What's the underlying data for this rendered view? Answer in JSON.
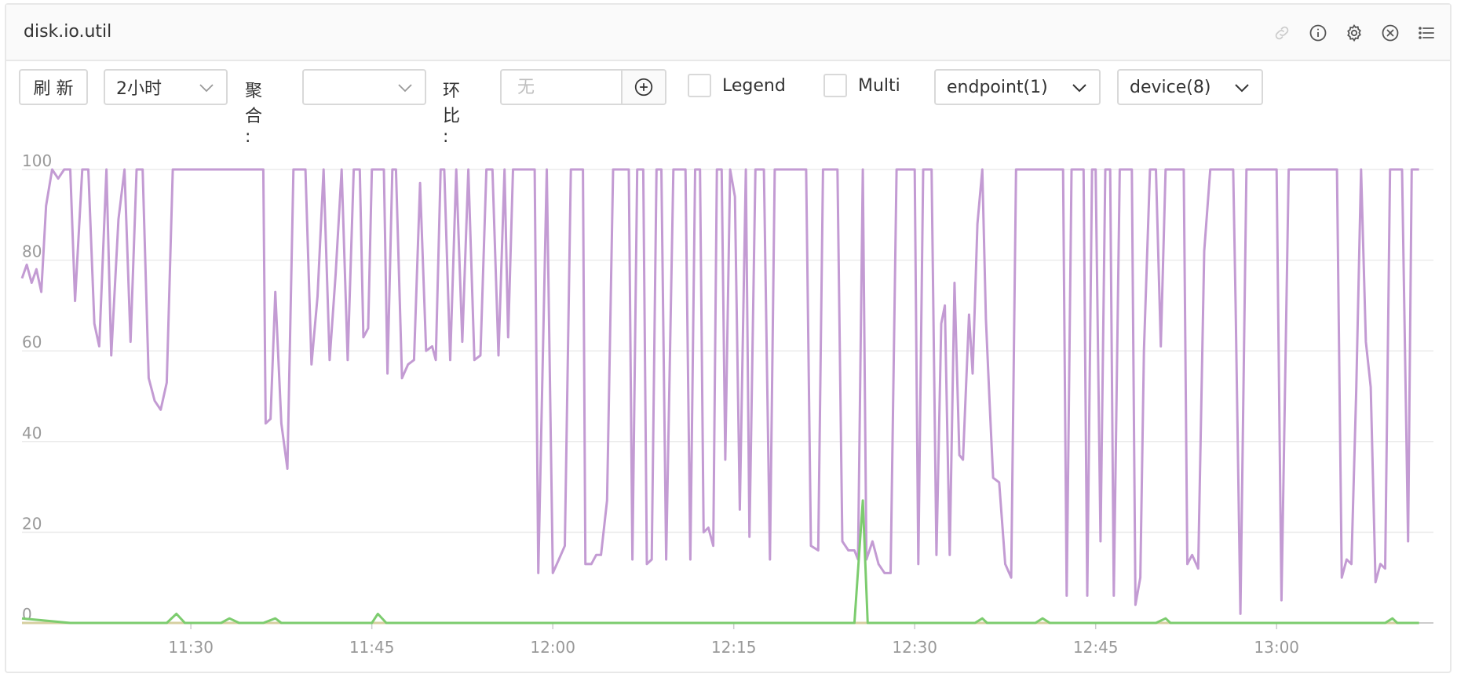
{
  "panel": {
    "title": "disk.io.util",
    "icons": [
      "link-icon",
      "info-icon",
      "gear-icon",
      "close-icon",
      "list-icon"
    ]
  },
  "toolbar": {
    "refresh_label": "刷 新",
    "time_range": "2小时",
    "aggregate_label": "聚合 :",
    "aggregate_value": "",
    "compare_label": "环比 :",
    "compare_placeholder": "无",
    "legend_label": "Legend",
    "multi_label": "Multi",
    "endpoint_label": "endpoint(1)",
    "device_label": "device(8)"
  },
  "colors": {
    "series_primary": "#c39bd3",
    "series_green": "#7ccc6e",
    "series_tan": "#d6cfa0",
    "grid": "#ebebeb",
    "axis": "#cccccc"
  },
  "chart_data": {
    "type": "line",
    "ylim": [
      0,
      100
    ],
    "y_ticks": [
      0,
      20,
      40,
      60,
      80,
      100
    ],
    "x_tick_labels": [
      "11:30",
      "11:45",
      "12:00",
      "12:15",
      "12:30",
      "12:45",
      "13:00"
    ],
    "x_tick_minutes": [
      690,
      705,
      720,
      735,
      750,
      765,
      780
    ],
    "x_range_minutes": [
      676,
      793
    ],
    "series": [
      {
        "color": "#c39bd3",
        "points": [
          [
            676,
            76
          ],
          [
            676.4,
            79
          ],
          [
            676.8,
            75
          ],
          [
            677.2,
            78
          ],
          [
            677.6,
            73
          ],
          [
            678,
            92
          ],
          [
            678.5,
            100
          ],
          [
            679,
            98
          ],
          [
            679.5,
            100
          ],
          [
            680,
            100
          ],
          [
            680.4,
            71
          ],
          [
            681,
            100
          ],
          [
            681.5,
            100
          ],
          [
            682,
            66
          ],
          [
            682.4,
            61
          ],
          [
            683,
            100
          ],
          [
            683.4,
            59
          ],
          [
            684,
            89
          ],
          [
            684.5,
            100
          ],
          [
            685,
            62
          ],
          [
            685.5,
            100
          ],
          [
            686,
            100
          ],
          [
            686.5,
            54
          ],
          [
            687,
            49
          ],
          [
            687.5,
            47
          ],
          [
            688,
            53
          ],
          [
            688.5,
            100
          ],
          [
            692,
            100
          ],
          [
            692,
            100
          ],
          [
            696,
            100
          ],
          [
            696.2,
            44
          ],
          [
            696.6,
            45
          ],
          [
            697,
            73
          ],
          [
            697.5,
            44
          ],
          [
            698,
            34
          ],
          [
            698.5,
            100
          ],
          [
            699.5,
            100
          ],
          [
            700,
            57
          ],
          [
            700.5,
            72
          ],
          [
            701,
            100
          ],
          [
            701.5,
            58
          ],
          [
            702,
            77
          ],
          [
            702.5,
            100
          ],
          [
            703,
            58
          ],
          [
            703.5,
            100
          ],
          [
            704,
            100
          ],
          [
            704.3,
            63
          ],
          [
            704.7,
            65
          ],
          [
            705,
            100
          ],
          [
            706,
            100
          ],
          [
            706.3,
            55
          ],
          [
            706.7,
            100
          ],
          [
            707,
            100
          ],
          [
            707.5,
            54
          ],
          [
            708,
            57
          ],
          [
            708.5,
            58
          ],
          [
            709,
            97
          ],
          [
            709.5,
            60
          ],
          [
            710,
            61
          ],
          [
            710.3,
            58
          ],
          [
            710.7,
            100
          ],
          [
            711,
            100
          ],
          [
            711.5,
            58
          ],
          [
            712,
            100
          ],
          [
            712.5,
            62
          ],
          [
            713,
            100
          ],
          [
            713.5,
            58
          ],
          [
            714,
            59
          ],
          [
            714.5,
            100
          ],
          [
            715,
            100
          ],
          [
            715.5,
            59
          ],
          [
            716,
            100
          ],
          [
            716.3,
            63
          ],
          [
            716.7,
            100
          ],
          [
            718.5,
            100
          ],
          [
            718.8,
            11
          ],
          [
            719.5,
            100
          ],
          [
            720,
            11
          ],
          [
            720.5,
            14
          ],
          [
            721,
            17
          ],
          [
            721.5,
            100
          ],
          [
            722.5,
            100
          ],
          [
            722.7,
            13
          ],
          [
            723.2,
            13
          ],
          [
            723.6,
            15
          ],
          [
            724,
            15
          ],
          [
            724.5,
            27
          ],
          [
            725,
            100
          ],
          [
            726.3,
            100
          ],
          [
            726.6,
            14
          ],
          [
            727,
            100
          ],
          [
            727.5,
            100
          ],
          [
            727.8,
            13
          ],
          [
            728.2,
            14
          ],
          [
            728.6,
            100
          ],
          [
            729,
            100
          ],
          [
            729.4,
            14
          ],
          [
            730,
            100
          ],
          [
            731,
            100
          ],
          [
            731.4,
            14
          ],
          [
            731.8,
            100
          ],
          [
            732.2,
            100
          ],
          [
            732.5,
            20
          ],
          [
            732.9,
            21
          ],
          [
            733.3,
            17
          ],
          [
            733.6,
            100
          ],
          [
            734,
            100
          ],
          [
            734.3,
            36
          ],
          [
            734.7,
            100
          ],
          [
            735.1,
            94
          ],
          [
            735.5,
            25
          ],
          [
            736,
            100
          ],
          [
            736.3,
            19
          ],
          [
            736.8,
            100
          ],
          [
            737.5,
            100
          ],
          [
            738,
            14
          ],
          [
            738.4,
            100
          ],
          [
            741,
            100
          ],
          [
            741.4,
            17
          ],
          [
            742,
            16
          ],
          [
            742.4,
            100
          ],
          [
            743.6,
            100
          ],
          [
            744,
            18
          ],
          [
            744.5,
            16
          ],
          [
            745,
            16
          ],
          [
            745.3,
            14
          ],
          [
            745.7,
            100
          ],
          [
            746,
            14
          ],
          [
            746.5,
            18
          ],
          [
            747,
            13
          ],
          [
            747.5,
            11
          ],
          [
            748,
            11
          ],
          [
            748.5,
            100
          ],
          [
            750,
            100
          ],
          [
            750.3,
            13
          ],
          [
            750.7,
            100
          ],
          [
            751.4,
            100
          ],
          [
            751.8,
            15
          ],
          [
            752.2,
            66
          ],
          [
            752.5,
            70
          ],
          [
            752.9,
            15
          ],
          [
            753.3,
            75
          ],
          [
            753.7,
            37
          ],
          [
            754,
            36
          ],
          [
            754.5,
            68
          ],
          [
            754.8,
            55
          ],
          [
            755.2,
            88
          ],
          [
            755.6,
            100
          ],
          [
            755.9,
            67
          ],
          [
            756.2,
            49
          ],
          [
            756.5,
            32
          ],
          [
            757,
            31
          ],
          [
            757.5,
            13
          ],
          [
            758,
            10
          ],
          [
            758.4,
            100
          ],
          [
            762.3,
            100
          ],
          [
            762.6,
            6
          ],
          [
            763,
            100
          ],
          [
            764,
            100
          ],
          [
            764.3,
            6
          ],
          [
            764.7,
            100
          ],
          [
            765,
            100
          ],
          [
            765.4,
            18
          ],
          [
            765.8,
            100
          ],
          [
            766.2,
            100
          ],
          [
            766.5,
            6
          ],
          [
            767,
            100
          ],
          [
            768,
            100
          ],
          [
            768.3,
            4
          ],
          [
            768.7,
            10
          ],
          [
            769,
            60
          ],
          [
            769.5,
            100
          ],
          [
            770,
            100
          ],
          [
            770.4,
            61
          ],
          [
            770.8,
            100
          ],
          [
            772.3,
            100
          ],
          [
            772.6,
            13
          ],
          [
            773,
            15
          ],
          [
            773.5,
            12
          ],
          [
            774,
            82
          ],
          [
            774.5,
            100
          ],
          [
            776.4,
            100
          ],
          [
            776.6,
            70
          ],
          [
            777,
            2
          ],
          [
            777.5,
            100
          ],
          [
            779,
            100
          ],
          [
            779.4,
            100
          ],
          [
            780,
            100
          ],
          [
            780.4,
            5
          ],
          [
            781,
            100
          ],
          [
            782,
            100
          ],
          [
            782.4,
            100
          ],
          [
            783,
            100
          ],
          [
            783.4,
            100
          ],
          [
            784.5,
            100
          ],
          [
            785,
            100
          ],
          [
            785.4,
            10
          ],
          [
            785.8,
            14
          ],
          [
            786.2,
            13
          ],
          [
            786.6,
            51
          ],
          [
            787,
            100
          ],
          [
            787.4,
            62
          ],
          [
            787.8,
            52
          ],
          [
            788.2,
            9
          ],
          [
            788.6,
            13
          ],
          [
            789,
            12
          ],
          [
            789.4,
            100
          ],
          [
            790,
            100
          ],
          [
            790.4,
            100
          ],
          [
            790.9,
            18
          ],
          [
            791.2,
            100
          ],
          [
            791.8,
            100
          ]
        ]
      },
      {
        "color": "#7ccc6e",
        "points": [
          [
            676,
            1
          ],
          [
            680,
            0
          ],
          [
            684,
            0
          ],
          [
            688,
            0
          ],
          [
            688.8,
            2
          ],
          [
            689.5,
            0
          ],
          [
            692.5,
            0
          ],
          [
            693.2,
            1
          ],
          [
            694,
            0
          ],
          [
            696,
            0
          ],
          [
            697,
            1
          ],
          [
            697.5,
            0
          ],
          [
            705,
            0
          ],
          [
            705.5,
            2
          ],
          [
            706.2,
            0
          ],
          [
            720,
            0
          ],
          [
            720.6,
            0
          ],
          [
            721.2,
            0
          ],
          [
            723,
            0
          ],
          [
            745,
            0
          ],
          [
            745.7,
            27
          ],
          [
            746.1,
            0
          ],
          [
            755,
            0
          ],
          [
            755.6,
            1
          ],
          [
            756,
            0
          ],
          [
            760,
            0
          ],
          [
            760.6,
            1
          ],
          [
            761.2,
            0
          ],
          [
            770,
            0
          ],
          [
            770.8,
            1
          ],
          [
            771.2,
            0
          ],
          [
            789,
            0
          ],
          [
            789.6,
            1
          ],
          [
            790,
            0
          ],
          [
            791.8,
            0
          ]
        ]
      },
      {
        "color": "#d6cfa0",
        "points": [
          [
            676,
            0
          ],
          [
            791.8,
            0
          ]
        ]
      }
    ]
  }
}
